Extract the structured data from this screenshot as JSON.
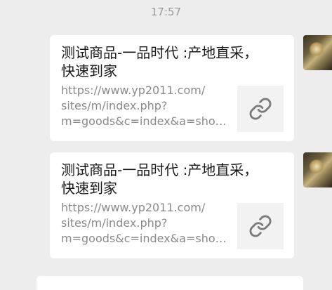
{
  "timestamp": "17:57",
  "messages": [
    {
      "title": "测试商品-一品时代 :产地直采，\n快速到家",
      "url_lines": [
        "https://www.yp2011.com/",
        "sites/m/index.php?",
        "m=goods&c=index&a=show…"
      ],
      "thumb_icon": "link-icon",
      "avatar_icon": "avatar-photo"
    },
    {
      "title": "测试商品-一品时代 :产地直采，\n快速到家",
      "url_lines": [
        "https://www.yp2011.com/",
        "sites/m/index.php?",
        "m=goods&c=index&a=show…"
      ],
      "thumb_icon": "link-icon",
      "avatar_icon": "avatar-photo"
    }
  ],
  "colors": {
    "background": "#ededed",
    "card": "#ffffff",
    "title_text": "#1a1a1a",
    "url_text": "#8a8a8a",
    "timestamp_text": "#9a9a9a",
    "icon": "#7a7a7a"
  }
}
